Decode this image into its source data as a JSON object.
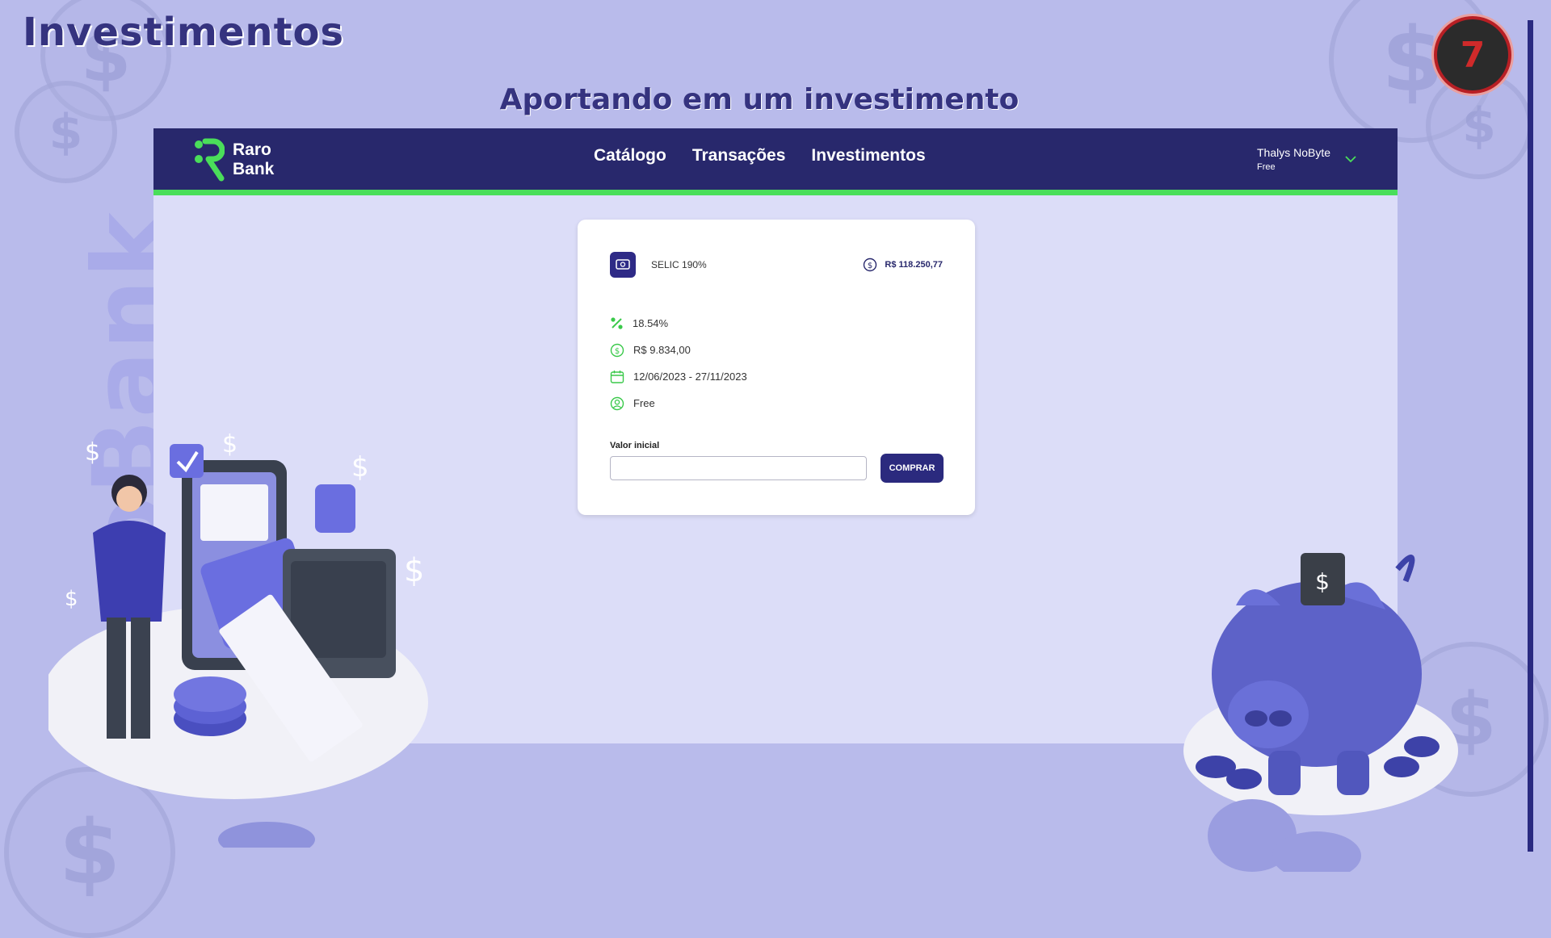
{
  "slide": {
    "title": "Investimentos",
    "subtitle": "Aportando em um investimento",
    "vertical_brand": "RaroBank"
  },
  "navbar": {
    "brand_line1": "Raro",
    "brand_line2": "Bank",
    "links": [
      "Catálogo",
      "Transações",
      "Investimentos"
    ],
    "user_name": "Thalys NoByte",
    "user_plan": "Free"
  },
  "investment": {
    "name": "SELIC 190%",
    "balance": "R$ 118.250,77",
    "details": [
      {
        "icon": "percent-icon",
        "text": "18.54%"
      },
      {
        "icon": "dollar-circle-icon",
        "text": "R$ 9.834,00"
      },
      {
        "icon": "calendar-icon",
        "text": "12/06/2023 - 27/11/2023"
      },
      {
        "icon": "user-circle-icon",
        "text": "Free"
      }
    ],
    "input_label": "Valor inicial",
    "input_value": "",
    "buy_label": "COMPRAR"
  },
  "colors": {
    "background": "#b9bbeb",
    "navbar": "#28286c",
    "accent_green": "#4ade5a",
    "primary_button": "#2b2a7e",
    "title": "#35337f"
  }
}
